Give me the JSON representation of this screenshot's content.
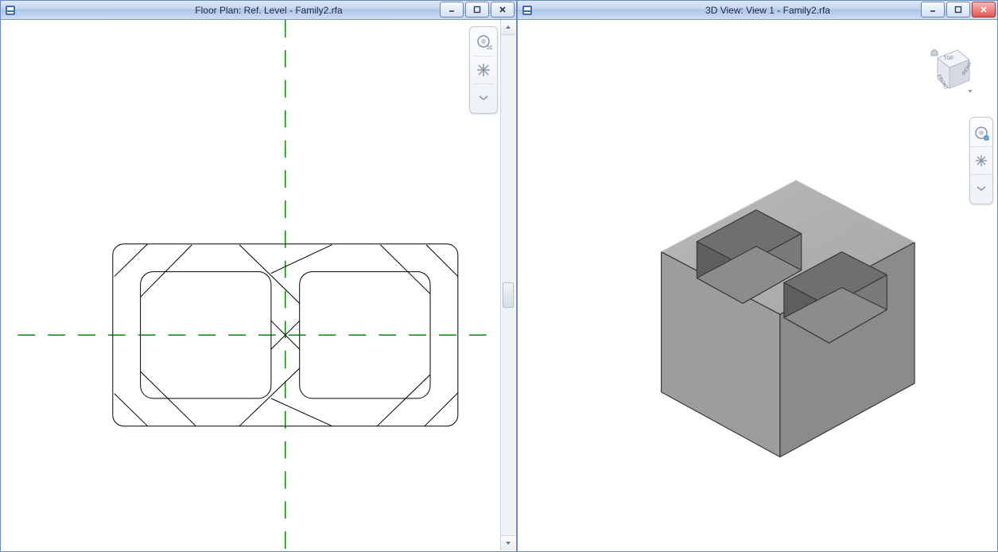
{
  "windows": {
    "left": {
      "title": "Floor Plan: Ref. Level - Family2.rfa",
      "tools": {
        "t1": "2D",
        "t2": "pan",
        "t3": "more"
      }
    },
    "right": {
      "title": "3D View: View 1 - Family2.rfa",
      "tools": {
        "t1": "wheel",
        "t2": "pan",
        "t3": "more"
      },
      "viewcube": {
        "top": "TOP",
        "front": "FRONT",
        "right": "RIGHT"
      }
    }
  },
  "window_controls": {
    "minimize": "minimize",
    "maximize": "maximize",
    "close": "close"
  }
}
